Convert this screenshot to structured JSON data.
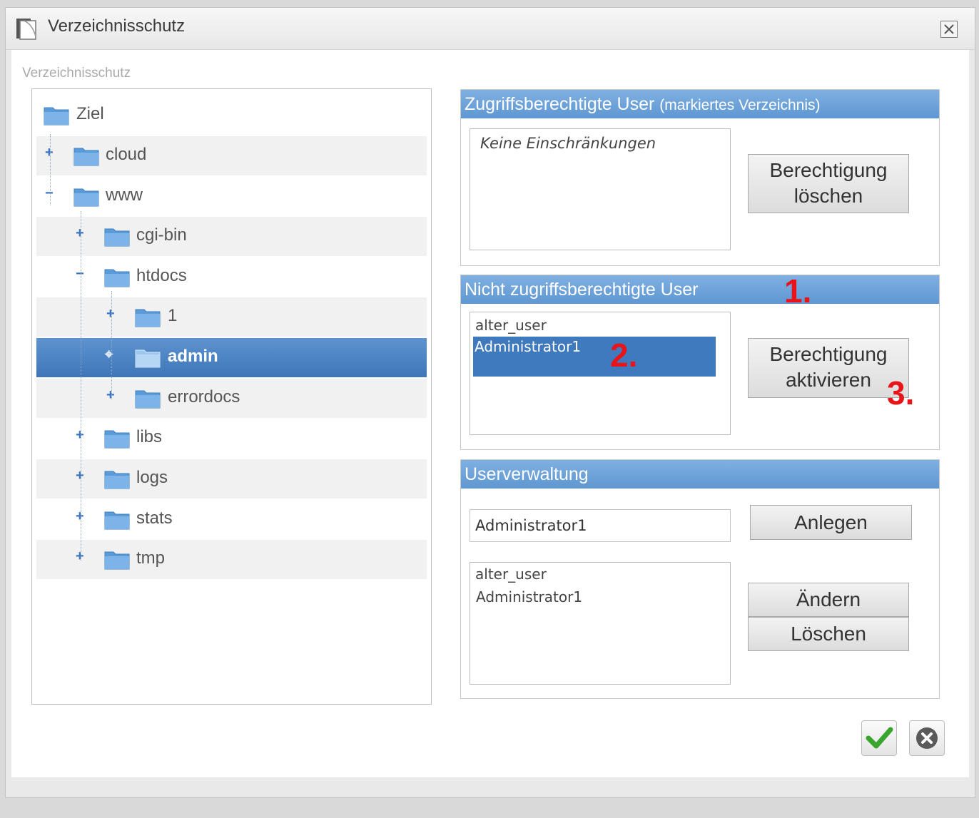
{
  "window": {
    "title": "Verzeichnisschutz",
    "close_icon": "close-icon"
  },
  "section_label": "Verzeichnisschutz",
  "tree": {
    "items": [
      {
        "label": "Ziel",
        "expander": "",
        "level": 0
      },
      {
        "label": "cloud",
        "expander": "+",
        "level": 1
      },
      {
        "label": "www",
        "expander": "−",
        "level": 1
      },
      {
        "label": "cgi-bin",
        "expander": "+",
        "level": 2
      },
      {
        "label": "htdocs",
        "expander": "−",
        "level": 2
      },
      {
        "label": "1",
        "expander": "+",
        "level": 3
      },
      {
        "label": "admin",
        "expander": "⌖",
        "level": 3,
        "selected": true
      },
      {
        "label": "errordocs",
        "expander": "+",
        "level": 3
      },
      {
        "label": "libs",
        "expander": "+",
        "level": 2
      },
      {
        "label": "logs",
        "expander": "+",
        "level": 2
      },
      {
        "label": "stats",
        "expander": "+",
        "level": 2
      },
      {
        "label": "tmp",
        "expander": "+",
        "level": 2
      }
    ]
  },
  "authorized": {
    "title": "Zugriffsberechtigte User",
    "subtitle": "(markiertes Verzeichnis)",
    "list": [
      "Keine Einschränkungen"
    ],
    "button_line1": "Berechtigung",
    "button_line2": "löschen"
  },
  "unauthorized": {
    "title": "Nicht zugriffsberechtigte User",
    "list": [
      "alter_user",
      "Administrator1"
    ],
    "selected": "Administrator1",
    "button_line1": "Berechtigung",
    "button_line2": "aktivieren"
  },
  "usermgmt": {
    "title": "Userverwaltung",
    "input_value": "Administrator1",
    "create_label": "Anlegen",
    "list": [
      "alter_user",
      "Administrator1"
    ],
    "change_label": "Ändern",
    "delete_label": "Löschen"
  },
  "annotations": {
    "a1": "1.",
    "a2": "2.",
    "a3": "3."
  },
  "footer": {
    "ok_icon": "checkmark-icon",
    "cancel_icon": "cancel-circle-icon"
  },
  "colors": {
    "header": "#6a9fd8",
    "selected": "#4a80c2",
    "annotation": "#e8141a",
    "ok": "#3aa52c"
  }
}
